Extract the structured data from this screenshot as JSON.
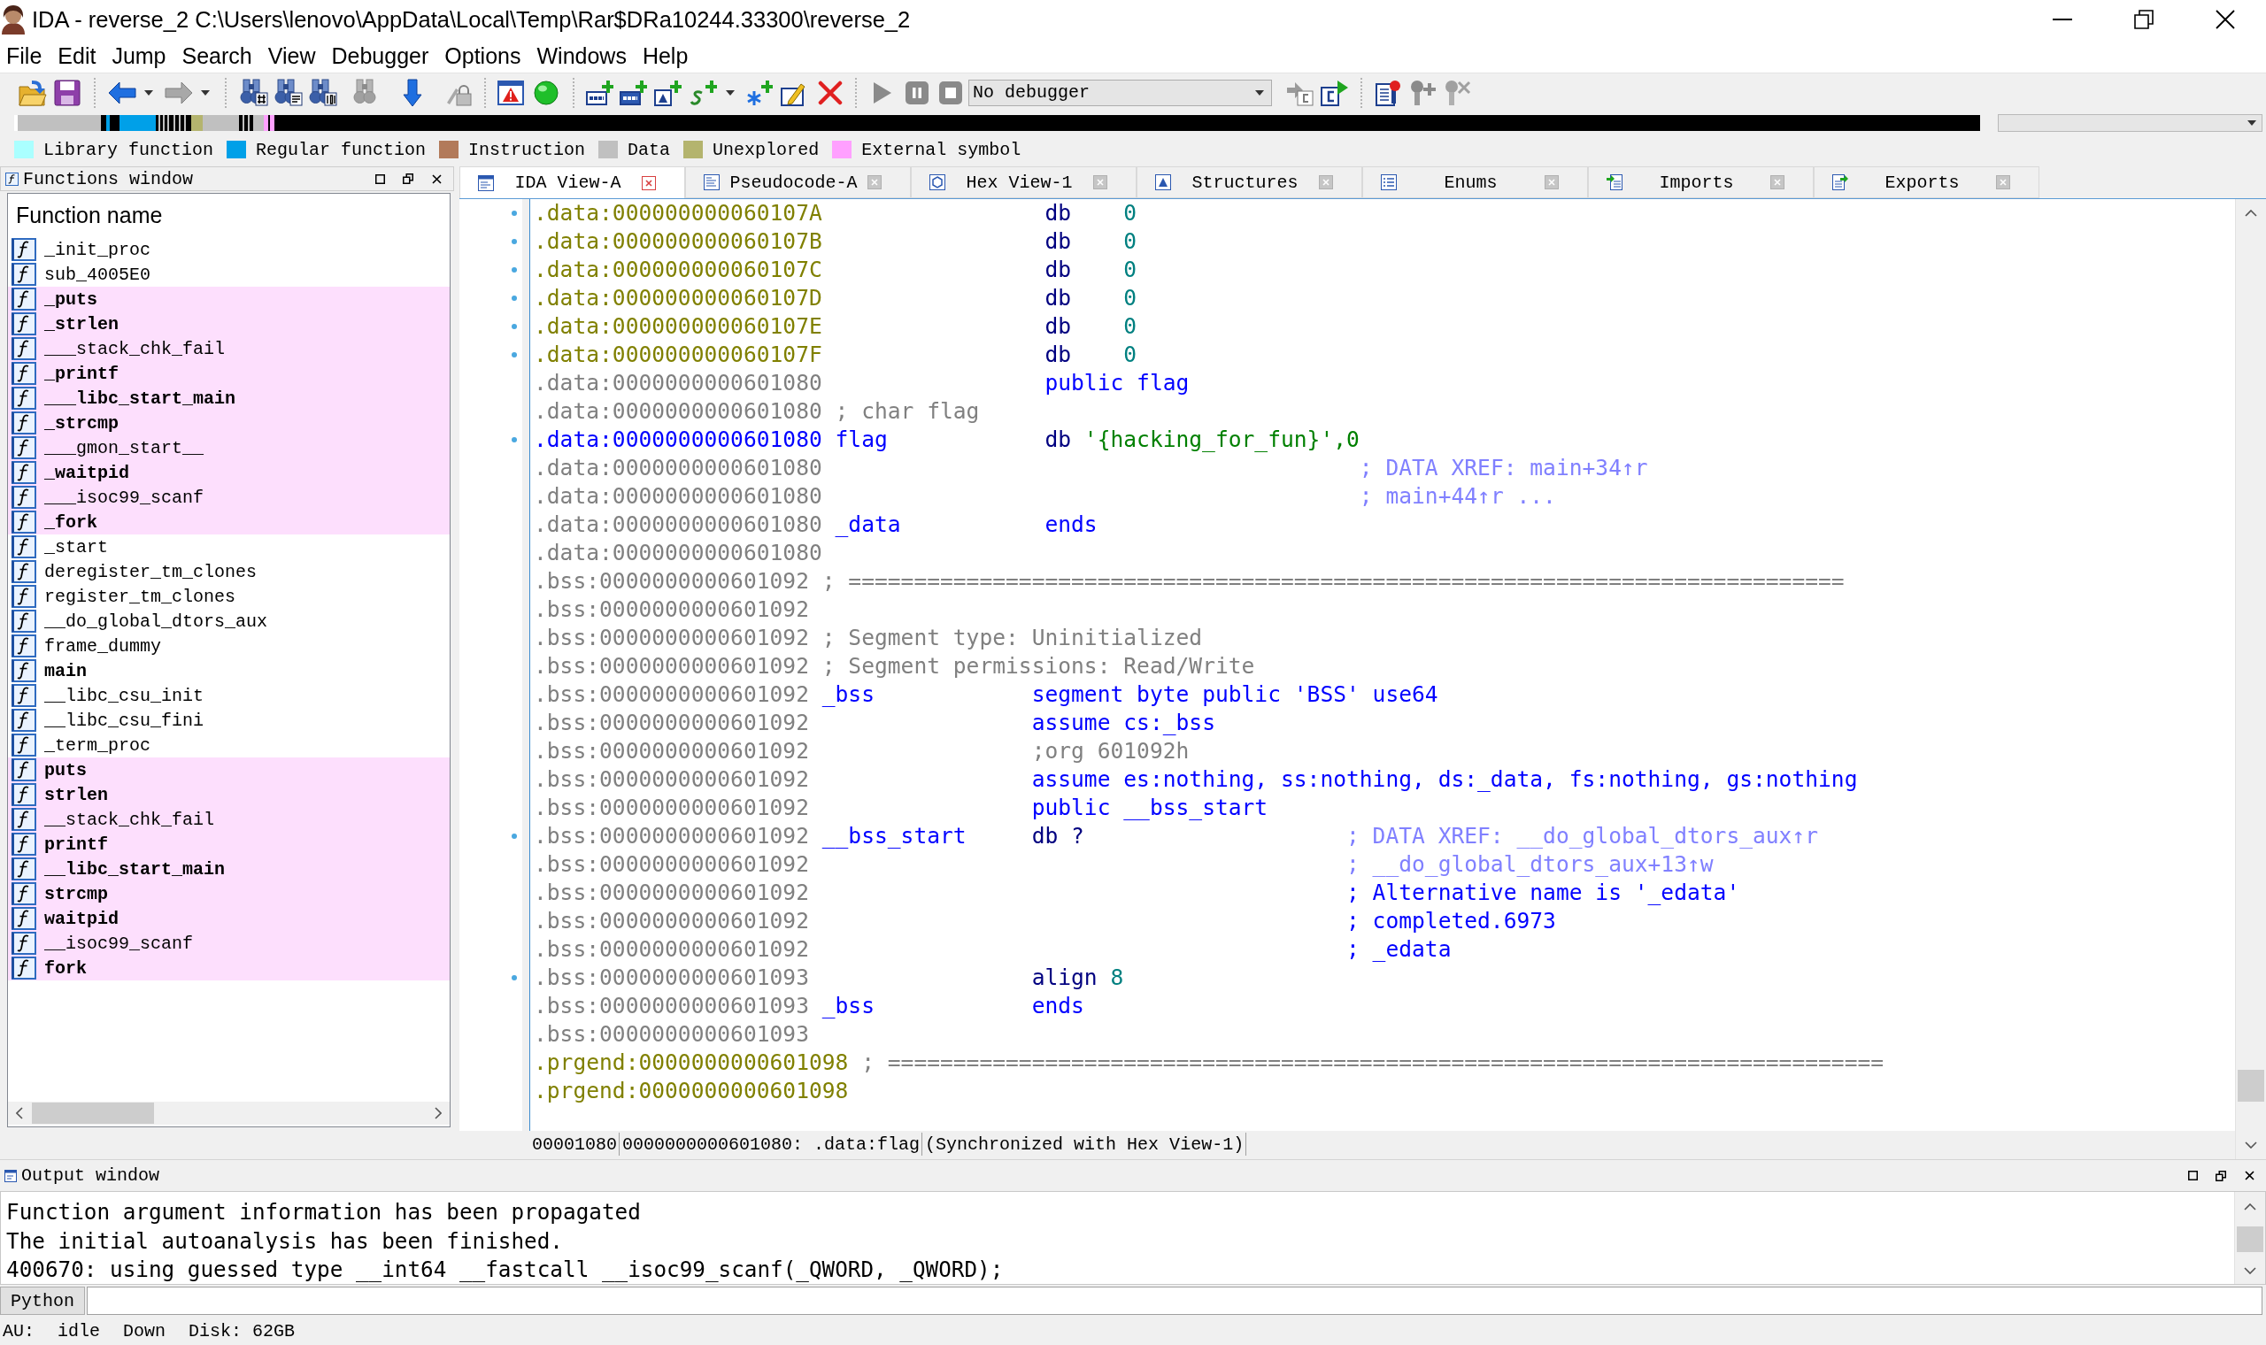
{
  "window": {
    "title": "IDA - reverse_2 C:\\Users\\lenovo\\AppData\\Local\\Temp\\Rar$DRa10244.33300\\reverse_2"
  },
  "menu": [
    "File",
    "Edit",
    "Jump",
    "Search",
    "View",
    "Debugger",
    "Options",
    "Windows",
    "Help"
  ],
  "toolbar": {
    "debugger": "No debugger"
  },
  "legend": [
    {
      "label": "Library function",
      "color": "#aaffff"
    },
    {
      "label": "Regular function",
      "color": "#00a0e8"
    },
    {
      "label": "Instruction",
      "color": "#b27a5a"
    },
    {
      "label": "Data",
      "color": "#c0c0c0"
    },
    {
      "label": "Unexplored",
      "color": "#b4b46e"
    },
    {
      "label": "External symbol",
      "color": "#ffa0ff"
    }
  ],
  "functions_window": {
    "title": "Functions window",
    "column_header": "Function name",
    "items": [
      {
        "name": "_init_proc",
        "external": false,
        "bold": false,
        "selected": false
      },
      {
        "name": "sub_4005E0",
        "external": false,
        "bold": false,
        "selected": false
      },
      {
        "name": "_puts",
        "external": true,
        "bold": true,
        "selected": false
      },
      {
        "name": "_strlen",
        "external": true,
        "bold": true,
        "selected": false
      },
      {
        "name": "___stack_chk_fail",
        "external": true,
        "bold": false,
        "selected": false
      },
      {
        "name": "_printf",
        "external": true,
        "bold": true,
        "selected": false
      },
      {
        "name": "___libc_start_main",
        "external": true,
        "bold": true,
        "selected": false
      },
      {
        "name": "_strcmp",
        "external": true,
        "bold": true,
        "selected": false
      },
      {
        "name": "___gmon_start__",
        "external": true,
        "bold": false,
        "selected": false
      },
      {
        "name": "_waitpid",
        "external": true,
        "bold": true,
        "selected": false
      },
      {
        "name": "___isoc99_scanf",
        "external": true,
        "bold": false,
        "selected": false
      },
      {
        "name": "_fork",
        "external": true,
        "bold": true,
        "selected": false
      },
      {
        "name": "_start",
        "external": false,
        "bold": false,
        "selected": false
      },
      {
        "name": "deregister_tm_clones",
        "external": false,
        "bold": false,
        "selected": false
      },
      {
        "name": "register_tm_clones",
        "external": false,
        "bold": false,
        "selected": false
      },
      {
        "name": "__do_global_dtors_aux",
        "external": false,
        "bold": false,
        "selected": false
      },
      {
        "name": "frame_dummy",
        "external": false,
        "bold": false,
        "selected": false
      },
      {
        "name": "main",
        "external": false,
        "bold": true,
        "selected": false
      },
      {
        "name": "__libc_csu_init",
        "external": false,
        "bold": false,
        "selected": false
      },
      {
        "name": "__libc_csu_fini",
        "external": false,
        "bold": false,
        "selected": false
      },
      {
        "name": "_term_proc",
        "external": false,
        "bold": false,
        "selected": false
      },
      {
        "name": "puts",
        "external": true,
        "bold": true,
        "selected": false
      },
      {
        "name": "strlen",
        "external": true,
        "bold": true,
        "selected": false
      },
      {
        "name": "__stack_chk_fail",
        "external": true,
        "bold": false,
        "selected": false
      },
      {
        "name": "printf",
        "external": true,
        "bold": true,
        "selected": false
      },
      {
        "name": "__libc_start_main",
        "external": true,
        "bold": true,
        "selected": false
      },
      {
        "name": "strcmp",
        "external": true,
        "bold": true,
        "selected": false
      },
      {
        "name": "waitpid",
        "external": true,
        "bold": true,
        "selected": false
      },
      {
        "name": "__isoc99_scanf",
        "external": true,
        "bold": false,
        "selected": false
      },
      {
        "name": "fork",
        "external": true,
        "bold": true,
        "selected": false
      }
    ]
  },
  "tabs": [
    {
      "label": "IDA View-A",
      "kind": "disassembly",
      "selected": true
    },
    {
      "label": "Pseudocode-A",
      "kind": "pseudocode",
      "selected": false
    },
    {
      "label": "Hex View-1",
      "kind": "hex",
      "selected": false
    },
    {
      "label": "Structures",
      "kind": "structures",
      "selected": false
    },
    {
      "label": "Enums",
      "kind": "enums",
      "selected": false
    },
    {
      "label": "Imports",
      "kind": "imports",
      "selected": false
    },
    {
      "label": "Exports",
      "kind": "exports",
      "selected": false
    }
  ],
  "disassembly": {
    "lines": [
      {
        "address": {
          "text": ".data:000000000060107A",
          "color": "#808000"
        },
        "dot": true,
        "code": [
          {
            "text": "db",
            "kind": "mnemonic"
          },
          {
            "text": "0",
            "kind": "number"
          }
        ]
      },
      {
        "address": {
          "text": ".data:000000000060107B",
          "color": "#808000"
        },
        "dot": true,
        "code": [
          {
            "text": "db",
            "kind": "mnemonic"
          },
          {
            "text": "0",
            "kind": "number"
          }
        ]
      },
      {
        "address": {
          "text": ".data:000000000060107C",
          "color": "#808000"
        },
        "dot": true,
        "code": [
          {
            "text": "db",
            "kind": "mnemonic"
          },
          {
            "text": "0",
            "kind": "number"
          }
        ]
      },
      {
        "address": {
          "text": ".data:000000000060107D",
          "color": "#808000"
        },
        "dot": true,
        "code": [
          {
            "text": "db",
            "kind": "mnemonic"
          },
          {
            "text": "0",
            "kind": "number"
          }
        ]
      },
      {
        "address": {
          "text": ".data:000000000060107E",
          "color": "#808000"
        },
        "dot": true,
        "code": [
          {
            "text": "db",
            "kind": "mnemonic"
          },
          {
            "text": "0",
            "kind": "number"
          }
        ]
      },
      {
        "address": {
          "text": ".data:000000000060107F",
          "color": "#808000"
        },
        "dot": true,
        "code": [
          {
            "text": "db",
            "kind": "mnemonic"
          },
          {
            "text": "0",
            "kind": "number"
          }
        ]
      },
      {
        "address": {
          "text": ".data:0000000000601080",
          "color": "#808080"
        },
        "dot": false,
        "code": [
          {
            "text": "public flag",
            "kind": "directive"
          }
        ]
      },
      {
        "address": {
          "text": ".data:0000000000601080",
          "color": "#808080"
        },
        "dot": false,
        "note": "; char flag"
      },
      {
        "address": {
          "text": ".data:0000000000601080",
          "color": "#0000ff"
        },
        "dot": true,
        "label": "flag",
        "code": [
          {
            "text": "db",
            "kind": "mnemonic"
          },
          {
            "text": "'{hacking_for_fun}',0",
            "kind": "string"
          }
        ]
      },
      {
        "address": {
          "text": ".data:0000000000601080",
          "color": "#808080"
        },
        "dot": false,
        "comment": {
          "text": "; DATA XREF: main+34↑r",
          "kind": "xref"
        }
      },
      {
        "address": {
          "text": ".data:0000000000601080",
          "color": "#808080"
        },
        "dot": false,
        "comment": {
          "text": "; main+44↑r ...",
          "kind": "xref"
        }
      },
      {
        "address": {
          "text": ".data:0000000000601080",
          "color": "#808080"
        },
        "dot": false,
        "label": "_data",
        "code": [
          {
            "text": "ends",
            "kind": "directive"
          }
        ]
      },
      {
        "address": {
          "text": ".data:0000000000601080",
          "color": "#808080"
        },
        "dot": false
      },
      {
        "address": {
          "text": ".bss:0000000000601092",
          "color": "#808080"
        },
        "dot": false,
        "note": "; ============================================================================"
      },
      {
        "address": {
          "text": ".bss:0000000000601092",
          "color": "#808080"
        },
        "dot": false
      },
      {
        "address": {
          "text": ".bss:0000000000601092",
          "color": "#808080"
        },
        "dot": false,
        "note": "; Segment type: Uninitialized"
      },
      {
        "address": {
          "text": ".bss:0000000000601092",
          "color": "#808080"
        },
        "dot": false,
        "note": "; Segment permissions: Read/Write"
      },
      {
        "address": {
          "text": ".bss:0000000000601092",
          "color": "#808080"
        },
        "dot": false,
        "label": "_bss",
        "code": [
          {
            "text": "segment byte public 'BSS' use64",
            "kind": "directive"
          }
        ]
      },
      {
        "address": {
          "text": ".bss:0000000000601092",
          "color": "#808080"
        },
        "dot": false,
        "code": [
          {
            "text": "assume cs:_bss",
            "kind": "directive"
          }
        ]
      },
      {
        "address": {
          "text": ".bss:0000000000601092",
          "color": "#808080"
        },
        "dot": false,
        "code": [
          {
            "text": ";org 601092h",
            "kind": "comment"
          }
        ]
      },
      {
        "address": {
          "text": ".bss:0000000000601092",
          "color": "#808080"
        },
        "dot": false,
        "code": [
          {
            "text": "assume es:nothing, ss:nothing, ds:_data, fs:nothing, gs:nothing",
            "kind": "directive"
          }
        ]
      },
      {
        "address": {
          "text": ".bss:0000000000601092",
          "color": "#808080"
        },
        "dot": false,
        "code": [
          {
            "text": "public __bss_start",
            "kind": "directive"
          }
        ]
      },
      {
        "address": {
          "text": ".bss:0000000000601092",
          "color": "#808080"
        },
        "dot": true,
        "label": "__bss_start",
        "code": [
          {
            "text": "db",
            "kind": "mnemonic"
          },
          {
            "text": "?",
            "kind": "unknown"
          }
        ],
        "comment": {
          "text": "; DATA XREF: __do_global_dtors_aux↑r",
          "kind": "xref"
        }
      },
      {
        "address": {
          "text": ".bss:0000000000601092",
          "color": "#808080"
        },
        "dot": false,
        "comment": {
          "text": "; __do_global_dtors_aux+13↑w",
          "kind": "xref"
        }
      },
      {
        "address": {
          "text": ".bss:0000000000601092",
          "color": "#808080"
        },
        "dot": false,
        "comment": {
          "text": "; Alternative name is '_edata'",
          "kind": "name"
        }
      },
      {
        "address": {
          "text": ".bss:0000000000601092",
          "color": "#808080"
        },
        "dot": false,
        "comment": {
          "text": "; completed.6973",
          "kind": "name"
        }
      },
      {
        "address": {
          "text": ".bss:0000000000601092",
          "color": "#808080"
        },
        "dot": false,
        "comment": {
          "text": "; _edata",
          "kind": "name"
        }
      },
      {
        "address": {
          "text": ".bss:0000000000601093",
          "color": "#808080"
        },
        "dot": true,
        "code": [
          {
            "text": "align",
            "kind": "mnemonic"
          },
          {
            "text": "8",
            "kind": "number"
          }
        ]
      },
      {
        "address": {
          "text": ".bss:0000000000601093",
          "color": "#808080"
        },
        "dot": false,
        "label": "_bss",
        "code": [
          {
            "text": "ends",
            "kind": "directive"
          }
        ]
      },
      {
        "address": {
          "text": ".bss:0000000000601093",
          "color": "#808080"
        },
        "dot": false
      },
      {
        "address": {
          "text": ".prgend:0000000000601098",
          "color": "#808000"
        },
        "dot": false,
        "note": "; ============================================================================"
      },
      {
        "address": {
          "text": ".prgend:0000000000601098",
          "color": "#808000"
        },
        "dot": false
      }
    ],
    "status": [
      "00001080",
      "0000000000601080: .data:flag",
      "(Synchronized with Hex View-1)"
    ]
  },
  "output_window": {
    "title": "Output window",
    "lines": [
      "Function argument information has been propagated",
      "The initial autoanalysis has been finished.",
      "400670: using guessed type __int64 __fastcall __isoc99_scanf(_QWORD, _QWORD);"
    ],
    "python_button": "Python"
  },
  "status_bar": [
    "AU:",
    "idle",
    "Down",
    "Disk: 62GB"
  ]
}
